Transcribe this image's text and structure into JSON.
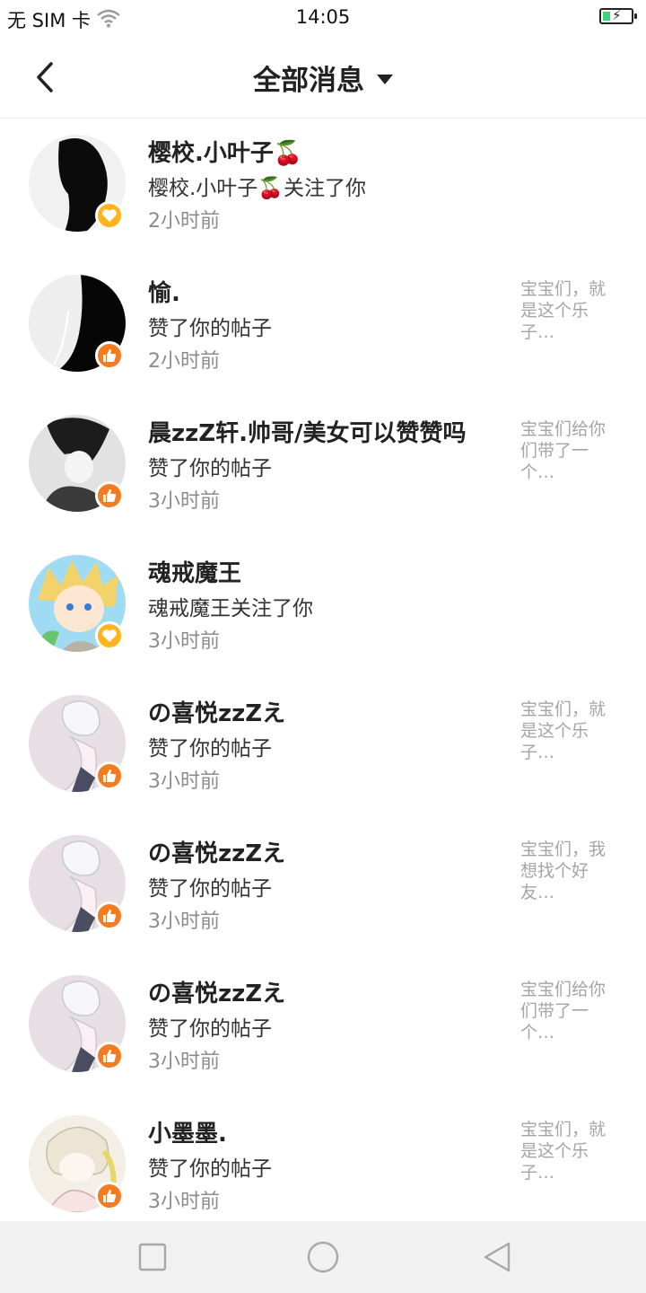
{
  "status_bar": {
    "carrier": "无 SIM 卡",
    "time": "14:05",
    "wifi_icon": "wifi-icon",
    "battery_icon": "battery-charging-icon"
  },
  "header": {
    "back_icon": "chevron-left-icon",
    "title": "全部消息",
    "dropdown_icon": "caret-down-icon"
  },
  "colors": {
    "like_badge": "#f57b21",
    "follow_badge": "#ffb41e",
    "muted_text": "#8c8c8c",
    "preview_text": "#a5a5a5"
  },
  "messages": [
    {
      "name": "樱校.小叶子🍒",
      "action": "樱校.小叶子🍒关注了你",
      "time": "2小时前",
      "badge": "follow",
      "preview": ""
    },
    {
      "name": "愉.",
      "action": "赞了你的帖子",
      "time": "2小时前",
      "badge": "like",
      "preview": "宝宝们，就是这个乐子…"
    },
    {
      "name": "晨zzZ轩.帅哥/美女可以赞赞吗",
      "action": "赞了你的帖子",
      "time": "3小时前",
      "badge": "like",
      "preview": "宝宝们给你们带了一个…"
    },
    {
      "name": "魂戒魔王",
      "action": "魂戒魔王关注了你",
      "time": "3小时前",
      "badge": "follow",
      "preview": ""
    },
    {
      "name": "の喜悦zzZえ",
      "action": "赞了你的帖子",
      "time": "3小时前",
      "badge": "like",
      "preview": "宝宝们，就是这个乐子…"
    },
    {
      "name": "の喜悦zzZえ",
      "action": "赞了你的帖子",
      "time": "3小时前",
      "badge": "like",
      "preview": "宝宝们，我想找个好友…"
    },
    {
      "name": "の喜悦zzZえ",
      "action": "赞了你的帖子",
      "time": "3小时前",
      "badge": "like",
      "preview": "宝宝们给你们带了一个…"
    },
    {
      "name": "小墨墨.",
      "action": "赞了你的帖子",
      "time": "3小时前",
      "badge": "like",
      "preview": "宝宝们，就是这个乐子…"
    }
  ],
  "nav_bar": {
    "recents_icon": "square-icon",
    "home_icon": "circle-icon",
    "back_icon": "triangle-back-icon"
  }
}
